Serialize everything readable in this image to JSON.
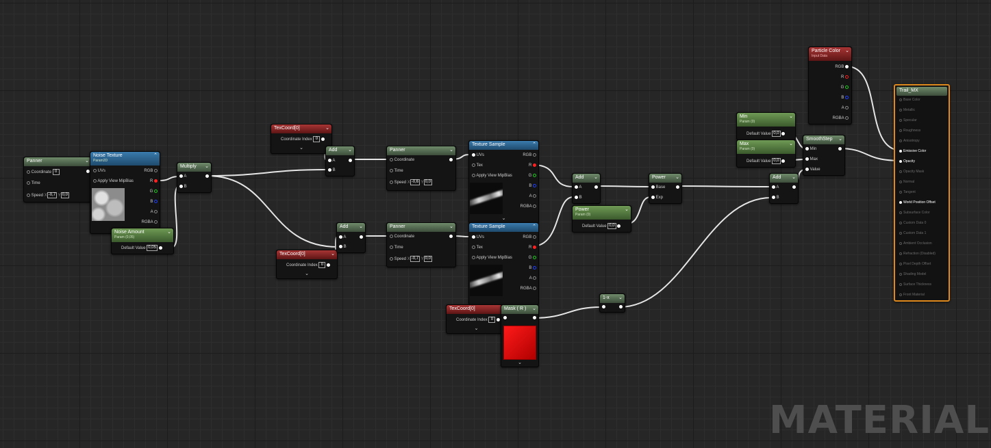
{
  "watermark": "MATERIAL",
  "panner1": {
    "title": "Panner",
    "coordinate": "Coordinate",
    "coord_val": "0",
    "time": "Time",
    "speed": "Speed",
    "x_lbl": "X",
    "x": "-0,7",
    "y_lbl": "Y",
    "y": "0,0"
  },
  "noise_tex": {
    "title": "Noise Texture",
    "sub": "Param2D",
    "uvs": "UVs",
    "mip": "Apply View MipBias",
    "rgb": "RGB",
    "r": "R",
    "g": "G",
    "b": "B",
    "a": "A",
    "rgba": "RGBA"
  },
  "noise_amount": {
    "title": "Noise Amount",
    "sub": "Param (0,05)",
    "label": "Default Value",
    "value": "0,05"
  },
  "multiply": {
    "title": "Multiply",
    "a": "A",
    "b": "B"
  },
  "texcoord1": {
    "title": "TexCoord[0]",
    "label": "Coordinate Index",
    "value": "0"
  },
  "texcoord2": {
    "title": "TexCoord[0]",
    "label": "Coordinate Index",
    "value": "0"
  },
  "texcoord3": {
    "title": "TexCoord[0]",
    "label": "Coordinate Index",
    "value": "0"
  },
  "add1": {
    "title": "Add",
    "a": "A",
    "b": "B"
  },
  "add2": {
    "title": "Add",
    "a": "A",
    "b": "B"
  },
  "add3": {
    "title": "Add",
    "a": "A",
    "b": "B"
  },
  "add4": {
    "title": "Add",
    "a": "A",
    "b": "B"
  },
  "panner2": {
    "title": "Panner",
    "coordinate": "Coordinate",
    "time": "Time",
    "speed": "Speed",
    "x_lbl": "X",
    "x": "-0,6",
    "y_lbl": "Y",
    "y": "0,0"
  },
  "panner3": {
    "title": "Panner",
    "coordinate": "Coordinate",
    "time": "Time",
    "speed": "Speed",
    "x_lbl": "X",
    "x": "-0,7",
    "y_lbl": "Y",
    "y": "0,0"
  },
  "texsample1": {
    "title": "Texture Sample",
    "uvs": "UVs",
    "tex": "Tex",
    "mip": "Apply View MipBias",
    "rgb": "RGB",
    "r": "R",
    "g": "G",
    "b": "B",
    "a": "A",
    "rgba": "RGBA"
  },
  "texsample2": {
    "title": "Texture Sample",
    "uvs": "UVs",
    "tex": "Tex",
    "mip": "Apply View MipBias",
    "rgb": "RGB",
    "r": "R",
    "g": "G",
    "b": "B",
    "a": "A",
    "rgba": "RGBA"
  },
  "mask": {
    "title": "Mask ( R )"
  },
  "power_param": {
    "title": "Power",
    "sub": "Param (0)",
    "label": "Default Value",
    "value": "0,0"
  },
  "power": {
    "title": "Power",
    "base": "Base",
    "exp": "Exp"
  },
  "one_minus": {
    "title": "1-x"
  },
  "min_param": {
    "title": "Min",
    "sub": "Param (0)",
    "label": "Default Value",
    "value": "0,0"
  },
  "max_param": {
    "title": "Max",
    "sub": "Param (0)",
    "label": "Default Value",
    "value": "0,0"
  },
  "smoothstep": {
    "title": "SmoothStep",
    "min": "Min",
    "max": "Max",
    "value": "Value"
  },
  "particle_color": {
    "title": "Particle Color",
    "sub": "Input Data",
    "rgb": "RGB",
    "r": "R",
    "g": "G",
    "b": "B",
    "a": "A",
    "rgba": "RGBA"
  },
  "output": {
    "title": "Trail_MX",
    "pins": [
      {
        "label": "Base Color",
        "active": false
      },
      {
        "label": "Metallic",
        "active": false
      },
      {
        "label": "Specular",
        "active": false
      },
      {
        "label": "Roughness",
        "active": false
      },
      {
        "label": "Anisotropy",
        "active": false
      },
      {
        "label": "Emissive Color",
        "active": true
      },
      {
        "label": "Opacity",
        "active": true
      },
      {
        "label": "Opacity Mask",
        "active": false
      },
      {
        "label": "Normal",
        "active": false
      },
      {
        "label": "Tangent",
        "active": false
      },
      {
        "label": "World Position Offset",
        "active": true
      },
      {
        "label": "Subsurface Color",
        "active": false
      },
      {
        "label": "Custom Data 0",
        "active": false
      },
      {
        "label": "Custom Data 1",
        "active": false
      },
      {
        "label": "Ambient Occlusion",
        "active": false
      },
      {
        "label": "Refraction (Disabled)",
        "active": false
      },
      {
        "label": "Pixel Depth Offset",
        "active": false
      },
      {
        "label": "Shading Model",
        "active": false
      },
      {
        "label": "Surface Thickness",
        "active": false
      },
      {
        "label": "Front Material",
        "active": false
      }
    ]
  },
  "colors": {
    "wire": "#e6e6e6",
    "output_border": "#e08a1e",
    "red_pin": "#ff2020",
    "green_pin": "#20d020",
    "blue_pin": "#2040ff"
  }
}
